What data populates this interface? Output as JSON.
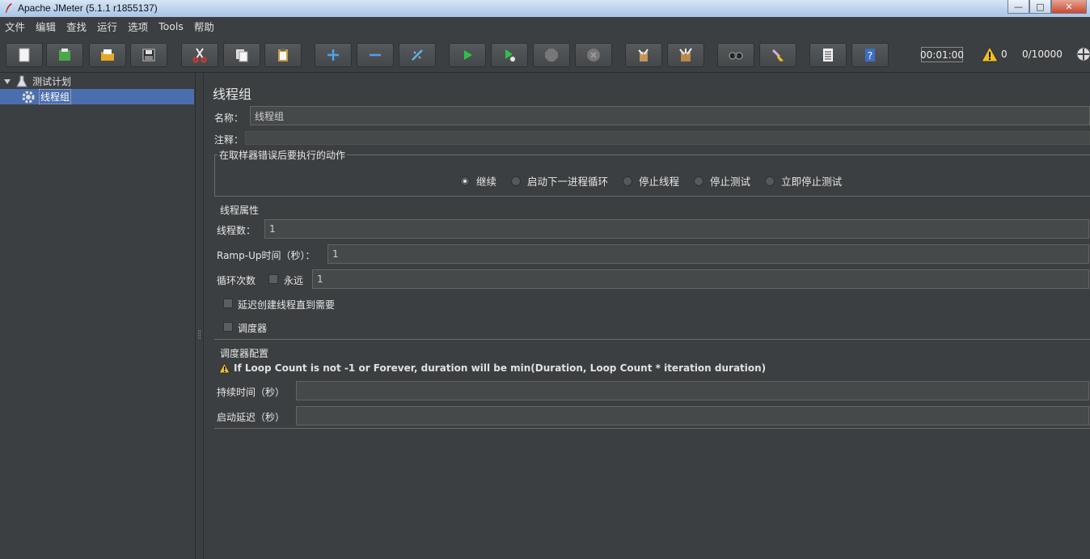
{
  "window": {
    "title": "Apache JMeter (5.1.1 r1855137)",
    "minimize": "—",
    "maximize": "□",
    "close": "✕"
  },
  "menu": [
    "文件",
    "编辑",
    "查找",
    "运行",
    "选项",
    "Tools",
    "帮助"
  ],
  "toolbar": {
    "buttons": [
      {
        "icon": "new-file-icon"
      },
      {
        "icon": "templates-icon"
      },
      {
        "icon": "open-icon"
      },
      {
        "icon": "save-icon"
      },
      {
        "icon": "cut-icon"
      },
      {
        "icon": "copy-icon"
      },
      {
        "icon": "paste-icon"
      },
      {
        "icon": "expand-icon"
      },
      {
        "icon": "collapse-icon"
      },
      {
        "icon": "toggle-icon"
      },
      {
        "icon": "start-icon"
      },
      {
        "icon": "start-no-pause-icon"
      },
      {
        "icon": "stop-icon"
      },
      {
        "icon": "shutdown-icon"
      },
      {
        "icon": "clear-icon"
      },
      {
        "icon": "clear-all-icon"
      },
      {
        "icon": "search-icon"
      },
      {
        "icon": "reset-search-icon"
      },
      {
        "icon": "function-helper-icon"
      },
      {
        "icon": "help-icon"
      }
    ],
    "timer": "00:01:00",
    "warning_count": "0",
    "thread_count": "0/10000"
  },
  "tree": {
    "root_label": "测试计划",
    "child_label": "线程组"
  },
  "panel": {
    "title": "线程组",
    "name_label": "名称：",
    "name_value": "线程组",
    "comment_label": "注释：",
    "comment_value": "",
    "error_action": {
      "legend": "在取样器错误后要执行的动作",
      "options": [
        "继续",
        "启动下一进程循环",
        "停止线程",
        "停止测试",
        "立即停止测试"
      ],
      "selected": "继续"
    },
    "thread_props": {
      "legend": "线程属性",
      "threads_label": "线程数：",
      "threads_value": "1",
      "rampup_label": "Ramp-Up时间（秒）：",
      "rampup_value": "1",
      "loop_label": "循环次数",
      "forever_label": "永远",
      "loop_value": "1",
      "delay_label": "延迟创建线程直到需要",
      "scheduler_label": "调度器"
    },
    "scheduler": {
      "legend": "调度器配置",
      "note": "If Loop Count is not -1 or Forever, duration will be min(Duration, Loop Count * iteration duration)",
      "duration_label": "持续时间（秒）",
      "duration_value": "",
      "startup_delay_label": "启动延迟（秒）",
      "startup_delay_value": ""
    }
  },
  "colors": {
    "background": "#3c3f41",
    "selection": "#4b6eaf",
    "field": "#45494a",
    "warning": "#f0c020",
    "play": "#2fc04a"
  }
}
